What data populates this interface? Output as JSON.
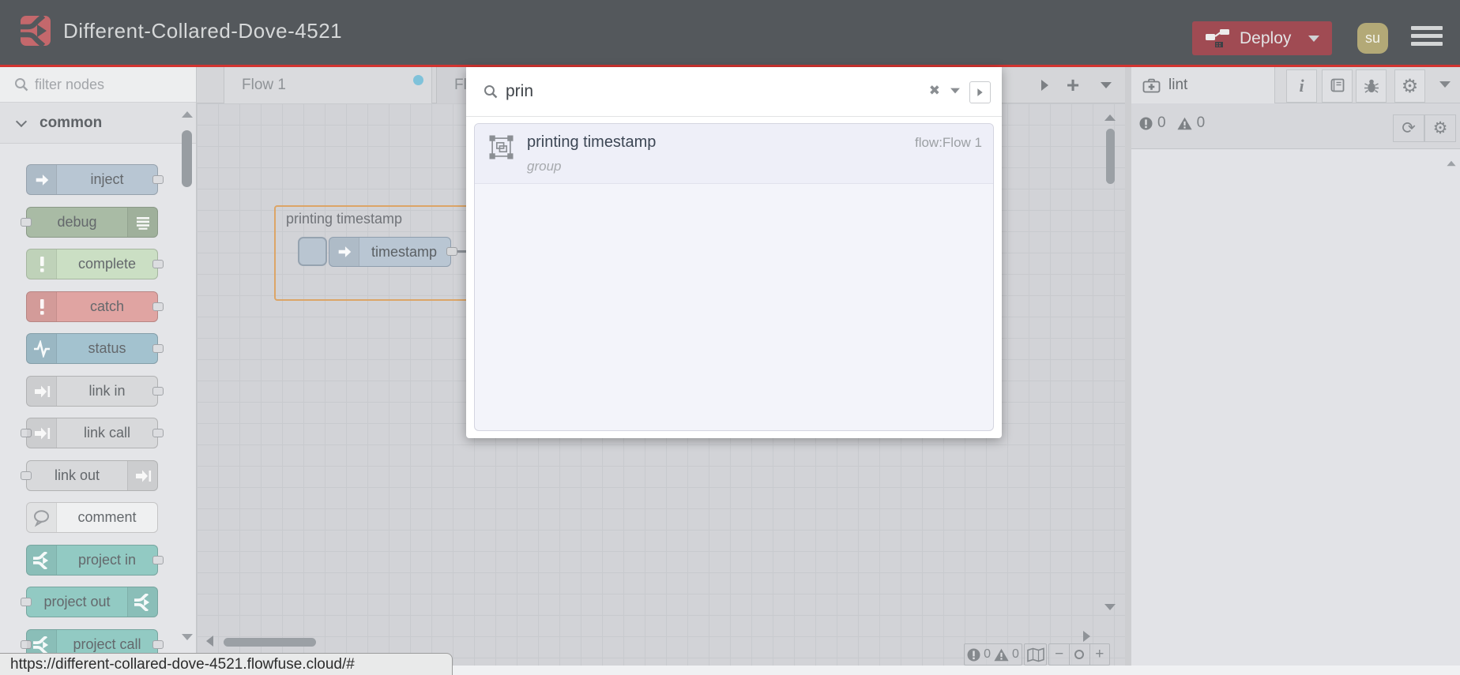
{
  "header": {
    "title": "Different-Collared-Dove-4521",
    "deploy_label": "Deploy",
    "avatar_initials": "su",
    "colors": {
      "bg": "#54585c",
      "accent_red": "#d23430",
      "deploy_bg": "#a04b53",
      "avatar_bg": "#b3a977",
      "logo_bg": "#c4686c"
    }
  },
  "palette": {
    "filter_placeholder": "filter nodes",
    "category_label": "common",
    "nodes": [
      {
        "label": "inject",
        "color": "#b8c6d3",
        "icon": "arrow-right-icon",
        "icon_side": "left",
        "ports": [
          "out"
        ]
      },
      {
        "label": "debug",
        "color": "#a9bba5",
        "icon": "list-icon",
        "icon_side": "right",
        "ports": [
          "in"
        ]
      },
      {
        "label": "complete",
        "color": "#cbdfc4",
        "icon": "exclaim-icon",
        "icon_side": "left",
        "ports": [
          "out"
        ]
      },
      {
        "label": "catch",
        "color": "#e0a4a2",
        "icon": "exclaim-icon",
        "icon_side": "left",
        "ports": [
          "out"
        ]
      },
      {
        "label": "status",
        "color": "#a3c2cf",
        "icon": "pulse-icon",
        "icon_side": "left",
        "ports": [
          "out"
        ]
      },
      {
        "label": "link in",
        "color": "#d8d9db",
        "icon": "link-icon",
        "icon_side": "left",
        "ports": [
          "out"
        ]
      },
      {
        "label": "link call",
        "color": "#d8d9db",
        "icon": "link-icon",
        "icon_side": "left",
        "ports": [
          "in",
          "out"
        ]
      },
      {
        "label": "link out",
        "color": "#d8d9db",
        "icon": "link-icon",
        "icon_side": "right",
        "ports": [
          "in"
        ]
      },
      {
        "label": "comment",
        "color": "#eff0f1",
        "icon": "comment-icon",
        "icon_side": "left",
        "ports": []
      },
      {
        "label": "project in",
        "color": "#92cac3",
        "icon": "project-icon",
        "icon_side": "left",
        "ports": [
          "out"
        ]
      },
      {
        "label": "project out",
        "color": "#92cac3",
        "icon": "project-icon",
        "icon_side": "right",
        "ports": [
          "in"
        ]
      },
      {
        "label": "project call",
        "color": "#92cac3",
        "icon": "project-icon",
        "icon_side": "left",
        "ports": [
          "in",
          "out"
        ]
      }
    ]
  },
  "tabs": {
    "active_label": "Flow 1",
    "partial_label": "Fl"
  },
  "canvas": {
    "group_title": "printing timestamp",
    "node_label": "timestamp",
    "group_border_color": "#dca567",
    "footer": {
      "errors": "0",
      "warnings": "0"
    }
  },
  "search": {
    "query": "prin",
    "result": {
      "title": "printing timestamp",
      "type": "group",
      "flow": "flow:Flow 1"
    }
  },
  "sidebar": {
    "tab_label": "lint",
    "errors": "0",
    "warnings": "0"
  },
  "statusbar": {
    "url": "https://different-collared-dove-4521.flowfuse.cloud/#"
  }
}
